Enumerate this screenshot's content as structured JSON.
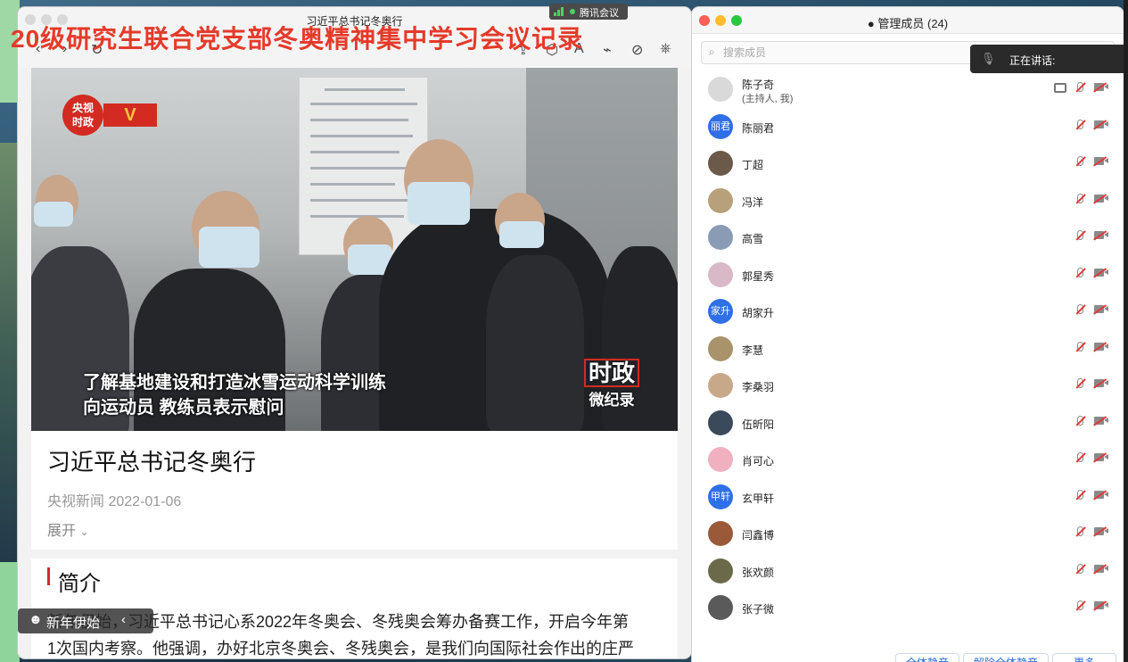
{
  "overlay_title": "20级研究生联合党支部冬奥精神集中学习会议记录",
  "browser": {
    "window_title": "习近平总书记冬奥行"
  },
  "tencent_meeting": {
    "label": "腾讯会议"
  },
  "video": {
    "logo_top": "央视",
    "logo_bottom": "时政",
    "subtitle_line1": "了解基地建设和打造冰雪运动科学训练",
    "subtitle_line2": "向运动员 教练员表示慰问",
    "watermark_top": "时政",
    "watermark_bottom": "微纪录"
  },
  "article": {
    "title": "习近平总书记冬奥行",
    "source": "央视新闻",
    "date": "2022-01-06",
    "expand_label": "展开",
    "section_title": "简介",
    "para_line1": "新年伊始，习近平总书记心系2022年冬奥会、冬残奥会筹办备赛工作，开启今年第",
    "para_line2": "1次国内考察。他强调，办好北京冬奥会、冬残奥会，是我们向国际社会作出的庄严"
  },
  "hover_pill": {
    "text": "新年伊始"
  },
  "members_panel": {
    "title": "管理成员 (24)",
    "search_placeholder": "搜索成员",
    "speaking_label": "正在讲话:",
    "members": [
      {
        "name": "陈子奇",
        "role": "(主持人, 我)",
        "avatar_color": "#d9d9d9",
        "avatar_text": ""
      },
      {
        "name": "陈丽君",
        "role": "",
        "avatar_color": "#2f6fe8",
        "avatar_text": "丽君"
      },
      {
        "name": "丁超",
        "role": "",
        "avatar_color": "#6b5a4a",
        "avatar_text": ""
      },
      {
        "name": "冯洋",
        "role": "",
        "avatar_color": "#b8a07a",
        "avatar_text": ""
      },
      {
        "name": "高雪",
        "role": "",
        "avatar_color": "#8a9bb5",
        "avatar_text": ""
      },
      {
        "name": "郭星秀",
        "role": "",
        "avatar_color": "#d9b8c8",
        "avatar_text": ""
      },
      {
        "name": "胡家升",
        "role": "",
        "avatar_color": "#2f6fe8",
        "avatar_text": "家升"
      },
      {
        "name": "李慧",
        "role": "",
        "avatar_color": "#a8936a",
        "avatar_text": ""
      },
      {
        "name": "李桑羽",
        "role": "",
        "avatar_color": "#c7a98a",
        "avatar_text": ""
      },
      {
        "name": "伍昕阳",
        "role": "",
        "avatar_color": "#3a4a5a",
        "avatar_text": ""
      },
      {
        "name": "肖可心",
        "role": "",
        "avatar_color": "#f0b0c0",
        "avatar_text": ""
      },
      {
        "name": "玄甲轩",
        "role": "",
        "avatar_color": "#2f6fe8",
        "avatar_text": "甲轩"
      },
      {
        "name": "闫鑫博",
        "role": "",
        "avatar_color": "#9a5a3a",
        "avatar_text": ""
      },
      {
        "name": "张欢颜",
        "role": "",
        "avatar_color": "#6a6a4a",
        "avatar_text": ""
      },
      {
        "name": "张子微",
        "role": "",
        "avatar_color": "#5a5a5a",
        "avatar_text": ""
      }
    ],
    "footer_buttons": [
      "全体静音",
      "解除全体静音",
      "更多"
    ]
  },
  "colors": {
    "accent_red": "#e53a2a",
    "link_blue": "#2f6fd6",
    "tencent_green": "#4cd264"
  }
}
